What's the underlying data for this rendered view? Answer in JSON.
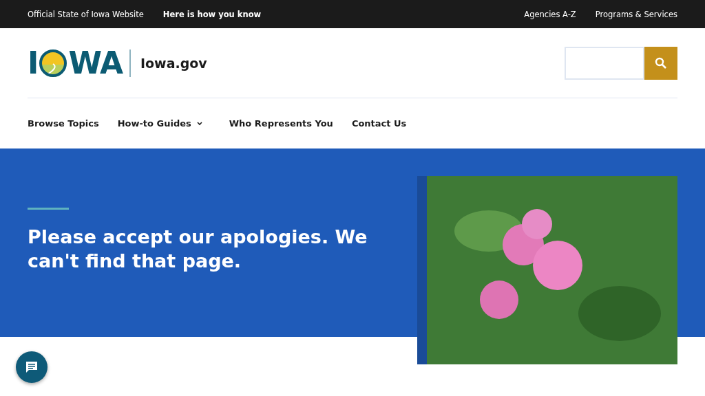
{
  "top_bar": {
    "official": "Official State of Iowa Website",
    "how_you_know": "Here is how you know",
    "links": [
      "Agencies A-Z",
      "Programs & Services"
    ]
  },
  "header": {
    "logo_start": "I",
    "logo_end": "WA",
    "site_name": "Iowa.gov"
  },
  "nav": [
    {
      "label": "Browse Topics",
      "has_menu": false
    },
    {
      "label": "How-to Guides",
      "has_menu": true
    },
    {
      "label": "Who Represents You",
      "has_menu": false
    },
    {
      "label": "Contact Us",
      "has_menu": false
    }
  ],
  "hero": {
    "heading": "Please accept our apologies. We can't find that page."
  }
}
